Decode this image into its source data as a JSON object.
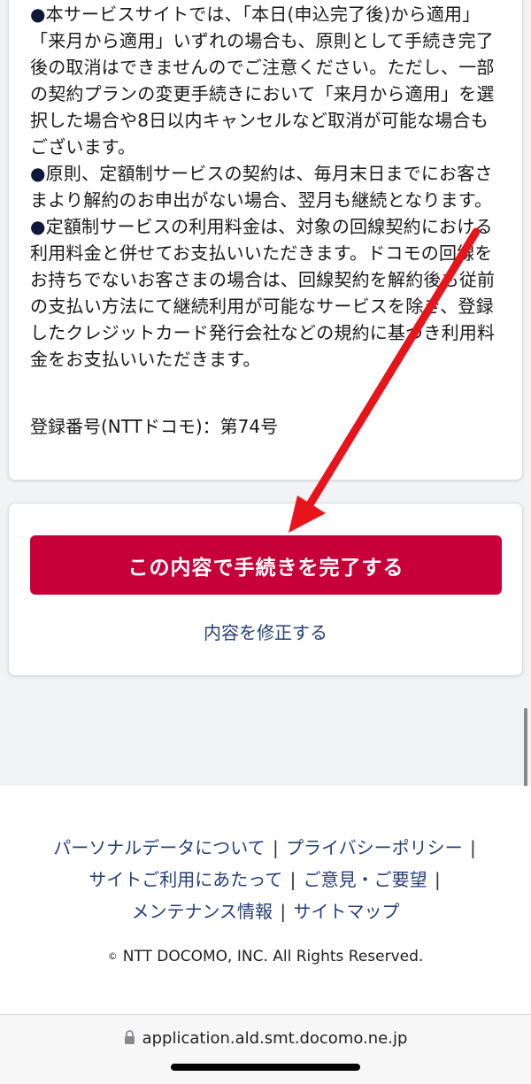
{
  "notes": [
    {
      "bullet": "●",
      "text": "本サービスサイトでは、「本日(申込完了後)から適用」「来月から適用」いずれの場合も、原則として手続き完了後の取消はできませんのでご注意ください。ただし、一部の契約プランの変更手続きにおいて「来月から適用」を選択した場合や8日以内キャンセルなど取消が可能な場合もございます。"
    },
    {
      "bullet": "●",
      "text": "原則、定額制サービスの契約は、毎月末日までにお客さまより解約のお申出がない場合、翌月も継続となります。"
    },
    {
      "bullet": "●",
      "text": "定額制サービスの利用料金は、対象の回線契約における利用料金と併せてお支払いいただきます。ドコモの回線をお持ちでないお客さまの場合は、回線契約を解約後も従前の支払い方法にて継続利用が可能なサービスを除き、登録したクレジットカード発行会社などの規約に基づき利用料金をお支払いいただきます。"
    }
  ],
  "registration": "登録番号(NTTドコモ)：第74号",
  "actions": {
    "complete_label": "この内容で手続きを完了する",
    "edit_label": "内容を修正する"
  },
  "footer": {
    "links": [
      "パーソナルデータについて",
      "プライバシーポリシー",
      "サイトご利用にあたって",
      "ご意見・ご要望",
      "メンテナンス情報",
      "サイトマップ"
    ],
    "separator": "|",
    "copyright_symbol": "©",
    "copyright": "NTT DOCOMO, INC. All Rights Reserved."
  },
  "browser": {
    "url": "application.ald.smt.docomo.ne.jp"
  },
  "colors": {
    "primary_button": "#c8003a",
    "link": "#243f7a",
    "annotation_arrow": "#e8141c"
  }
}
